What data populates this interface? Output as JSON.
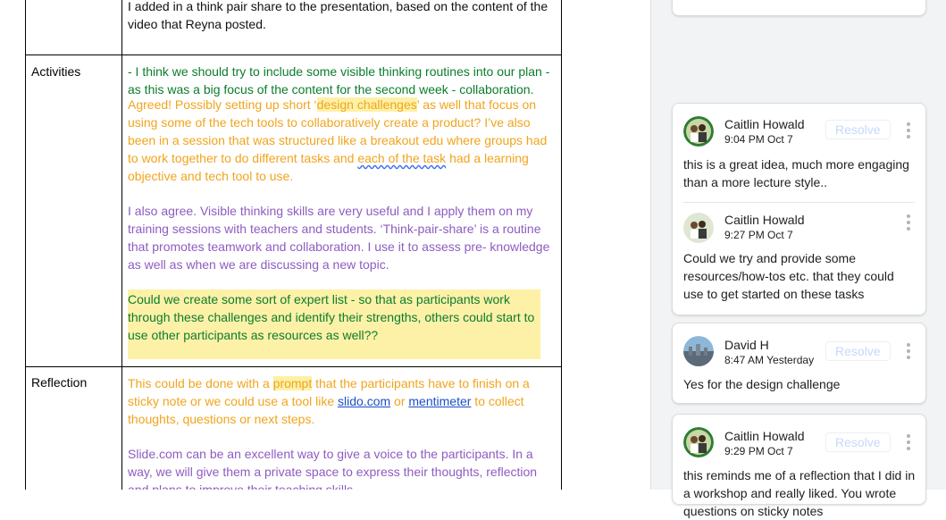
{
  "doc": {
    "top_text": "I added in a think pair share to the presentation, based on the content of the video that Reyna posted.",
    "activities_label": "Activities",
    "reflection_label": "Reflection",
    "act_p1": "- I think we should try to include some visible thinking routines into our plan - as this was a big focus of the content for the second week - collaboration.",
    "act_p2_a": "Agreed! Possibly setting up short ‘",
    "act_p2_hl": "design challenges",
    "act_p2_b": "’  as well that focus on using some of the tech tools to collaboratively create a product? I’ve also been in a session that was structured like a breakout edu where groups had to work together to do different tasks and ",
    "act_p2_squig": "each of the task",
    "act_p2_c": " had a learning objective and tech tool to use.",
    "act_p3": "I also agree. Visible thinking skills are very useful and I apply them on my training sessions with teachers and  students. ‘Think-pair-share’ is a routine that promotes teamwork and collaboration. I use it to assess pre- knowledge as well as when we are discussing a new topic.",
    "act_p4": "Could we create some sort of expert list - so that as participants work through these challenges and identify their strengths, others could start to use other participants as resources as well??",
    "ref_p1_a": "This could be done with a ",
    "ref_p1_hl": "prompt",
    "ref_p1_b": " that the participants have to finish on a sticky note or we could use a tool like ",
    "ref_link1": "slido.com",
    "ref_p1_c": "  or ",
    "ref_link2": "mentimeter",
    "ref_p1_d": " to collect thoughts, questions or next steps.",
    "ref_p2": "Slide.com can be an excellent way to give a voice to the participants. In a way, we will give them a private space to express their thoughts, reflection and plans to improve their teaching skills."
  },
  "comments": {
    "resolve_label": "Resolve",
    "c1": {
      "author": "Caitlin Howald",
      "time": "9:04 PM Oct 7",
      "text": "this is a great idea, much more engaging than a more lecture style.."
    },
    "c1_reply": {
      "author": "Caitlin Howald",
      "time": "9:27 PM Oct 7",
      "text": "Could we try and provide some resources/how-tos etc. that they could use to get started on these tasks"
    },
    "c2": {
      "author": "David H",
      "time": "8:47 AM Yesterday",
      "text": "Yes for the design challenge"
    },
    "c3": {
      "author": "Caitlin Howald",
      "time": "9:29 PM Oct 7",
      "text": "this reminds me of a reflection that I did in a workshop and really liked. You wrote questions on sticky notes"
    }
  },
  "icons": [
    "avatar-caitlin-icon",
    "avatar-david-icon",
    "more-vert-icon"
  ],
  "colors": {
    "green_text": "#0b7d2c",
    "orange_text": "#f1a41d",
    "purple_text": "#8e5cc1",
    "highlight": "#fdf1a8",
    "link": "#1a4ec7",
    "resolve": "#c5d9f7"
  }
}
